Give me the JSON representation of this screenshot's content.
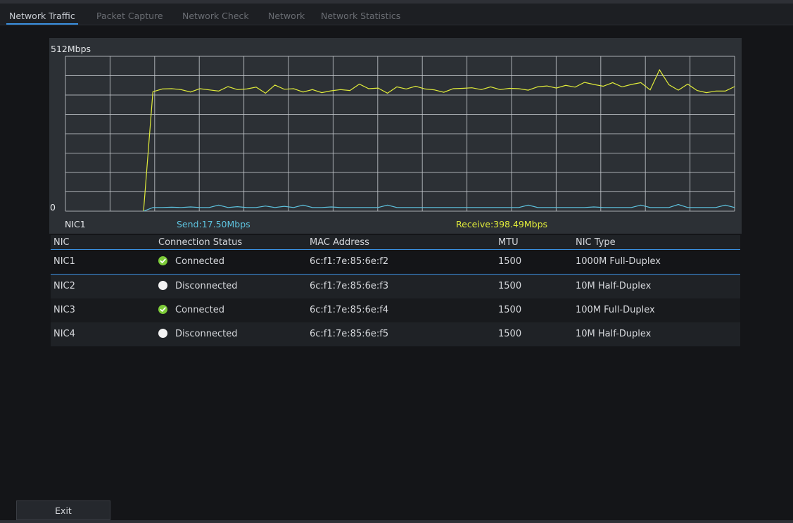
{
  "tabs": [
    {
      "label": "Network Traffic",
      "active": true
    },
    {
      "label": "Packet Capture",
      "active": false
    },
    {
      "label": "Network Check",
      "active": false
    },
    {
      "label": "Network",
      "active": false
    },
    {
      "label": "Network Statistics",
      "active": false
    }
  ],
  "chart": {
    "y_max_label": "512Mbps",
    "y_min_label": "0",
    "nic_label": "NIC1",
    "send_label": "Send:17.50Mbps",
    "receive_label": "Receive:398.49Mbps",
    "colors": {
      "send": "#5ec4e0",
      "receive": "#e1ec3a",
      "grid": "#c8ccd0",
      "background": "#2c3035"
    }
  },
  "chart_data": {
    "type": "line",
    "ylim": [
      0,
      512
    ],
    "y_tick_labels": [
      "0",
      "512Mbps"
    ],
    "grid": true,
    "series": [
      {
        "name": "Receive",
        "values": [
          0,
          0,
          0,
          0,
          0,
          0,
          0,
          0,
          395,
          404,
          405,
          402,
          394,
          405,
          401,
          397,
          412,
          402,
          404,
          410,
          390,
          417,
          403,
          405,
          394,
          402,
          392,
          398,
          402,
          399,
          420,
          405,
          407,
          390,
          411,
          404,
          413,
          404,
          401,
          393,
          405,
          406,
          408,
          402,
          411,
          402,
          406,
          405,
          400,
          411,
          414,
          407,
          416,
          410,
          426,
          419,
          413,
          425,
          411,
          419,
          425,
          401,
          467,
          418,
          400,
          420,
          399,
          392,
          397,
          397,
          412
        ]
      },
      {
        "name": "Send",
        "values": [
          0,
          0,
          0,
          0,
          0,
          0,
          0,
          0,
          12,
          12,
          13,
          12,
          14,
          12,
          12,
          20,
          12,
          15,
          12,
          12,
          17,
          12,
          16,
          12,
          20,
          12,
          12,
          14,
          12,
          12,
          12,
          12,
          12,
          20,
          12,
          12,
          12,
          12,
          12,
          12,
          12,
          12,
          12,
          12,
          12,
          12,
          12,
          12,
          20,
          12,
          12,
          12,
          12,
          12,
          12,
          14,
          12,
          12,
          12,
          12,
          20,
          12,
          12,
          12,
          22,
          12,
          12,
          12,
          12,
          20,
          12
        ]
      }
    ]
  },
  "table": {
    "headers": [
      "NIC",
      "Connection Status",
      "MAC Address",
      "MTU",
      "NIC Type"
    ],
    "rows": [
      {
        "nic": "NIC1",
        "status": "Connected",
        "connected": true,
        "mac": "6c:f1:7e:85:6e:f2",
        "mtu": "1500",
        "type": "1000M Full-Duplex"
      },
      {
        "nic": "NIC2",
        "status": "Disconnected",
        "connected": false,
        "mac": "6c:f1:7e:85:6e:f3",
        "mtu": "1500",
        "type": "10M Half-Duplex"
      },
      {
        "nic": "NIC3",
        "status": "Connected",
        "connected": true,
        "mac": "6c:f1:7e:85:6e:f4",
        "mtu": "1500",
        "type": "100M Full-Duplex"
      },
      {
        "nic": "NIC4",
        "status": "Disconnected",
        "connected": false,
        "mac": "6c:f1:7e:85:6e:f5",
        "mtu": "1500",
        "type": "10M Half-Duplex"
      }
    ]
  },
  "footer": {
    "exit_label": "Exit"
  }
}
